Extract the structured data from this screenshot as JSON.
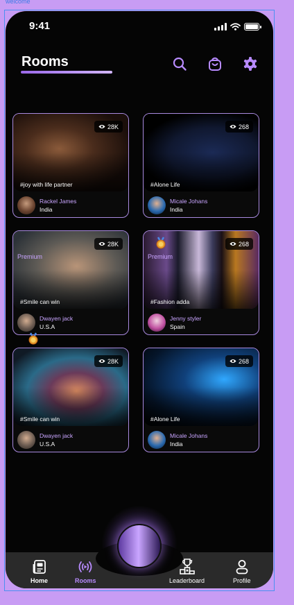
{
  "frame_label": "welcome",
  "status_bar": {
    "time": "9:41"
  },
  "header": {
    "title": "Rooms"
  },
  "rooms": [
    {
      "tag": "#joy with life partner",
      "views": "28K",
      "premium": "",
      "host": "Rackel James",
      "country": "India"
    },
    {
      "tag": "#Alone Life",
      "views": "268",
      "premium": "",
      "host": "Micale Johans",
      "country": "India"
    },
    {
      "tag": "#Smile can win",
      "views": "28K",
      "premium": "Premium",
      "host": "Dwayen jack",
      "country": "U.S.A"
    },
    {
      "tag": "#Fashion adda",
      "views": "268",
      "premium": "Premium",
      "host": "Jenny styler",
      "country": "Spain"
    },
    {
      "tag": "#Smile can win",
      "views": "28K",
      "premium": "",
      "host": "Dwayen jack",
      "country": "U.S.A"
    },
    {
      "tag": "#Alone Life",
      "views": "268",
      "premium": "",
      "host": "Micale Johans",
      "country": "India"
    }
  ],
  "nav": {
    "home": "Home",
    "rooms": "Rooms",
    "leaderboard": "Leaderboard",
    "profile": "Profile"
  },
  "colors": {
    "accent": "#b88bff",
    "card_border": "#a98ae0",
    "background": "#050505"
  },
  "icons": [
    "search-icon",
    "shopping-bag-icon",
    "gear-icon",
    "eye-icon",
    "medal-icon",
    "newspaper-icon",
    "broadcast-icon",
    "trophy-icon",
    "user-icon"
  ]
}
